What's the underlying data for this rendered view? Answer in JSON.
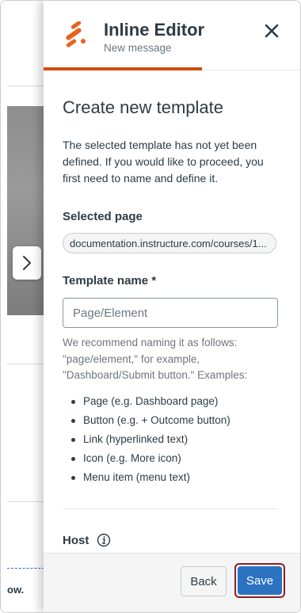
{
  "background": {
    "partial_text": "ow."
  },
  "header": {
    "title": "Inline Editor",
    "subtitle": "New message",
    "accent_color": "#d24d0f"
  },
  "main": {
    "heading": "Create new template",
    "intro": "The selected template has not yet been defined. If you would like to proceed, you first need to name and define it.",
    "selected_page_label": "Selected page",
    "selected_page_value": "documentation.instructure.com/courses/1...",
    "template_name_label": "Template name *",
    "template_name_placeholder": "Page/Element",
    "help_text": "We recommend naming it as follows: \"page/element,\" for example, \"Dashboard/Submit button.\" Examples:",
    "examples": [
      "Page (e.g. Dashboard page)",
      "Button (e.g. + Outcome button)",
      "Link (hyperlinked text)",
      "Icon (e.g. More icon)",
      "Menu item (menu text)"
    ],
    "host_label": "Host"
  },
  "footer": {
    "back_label": "Back",
    "save_label": "Save",
    "save_color": "#2b73c1"
  }
}
